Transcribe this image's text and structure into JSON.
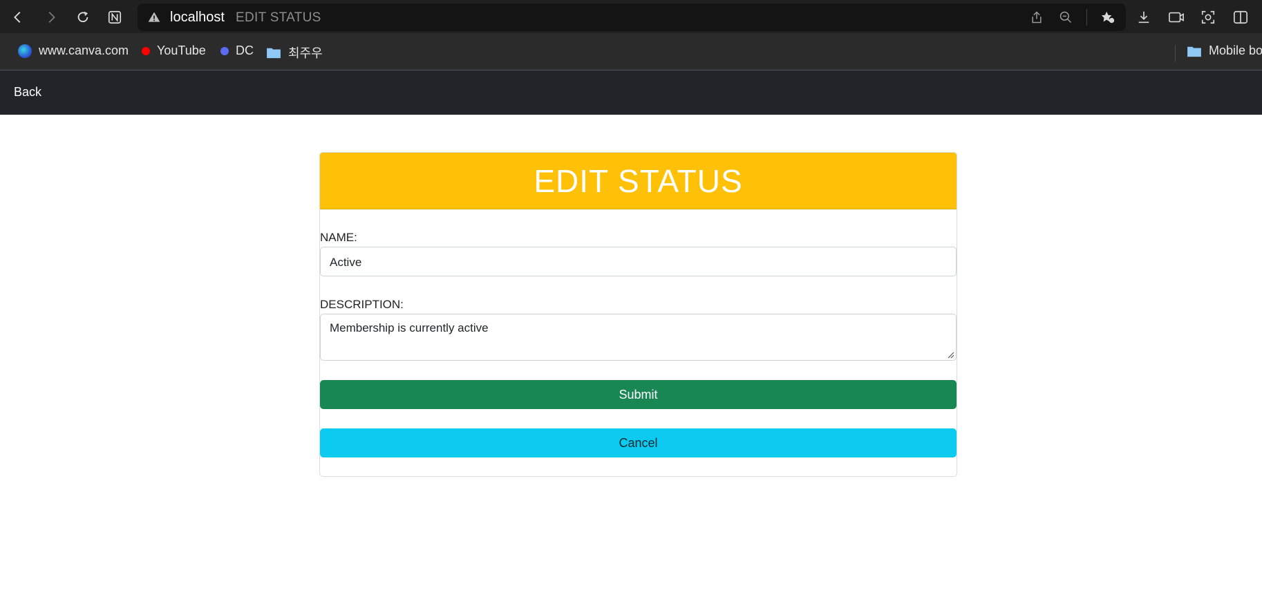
{
  "browser": {
    "address": {
      "host": "localhost",
      "page_title": "EDIT STATUS"
    },
    "bookmarks": [
      {
        "label": "www.canva.com",
        "icon": "canva-icon"
      },
      {
        "label": "YouTube",
        "icon": "youtube-dot-icon",
        "color": "#ff0000"
      },
      {
        "label": "DC",
        "icon": "dc-dot-icon",
        "color": "#5b6cf0"
      },
      {
        "label": "최주우",
        "icon": "folder-icon"
      },
      {
        "label": "Mobile bo",
        "icon": "folder-icon"
      }
    ]
  },
  "navbar": {
    "back_label": "Back"
  },
  "form": {
    "title": "EDIT STATUS",
    "name_label": "NAME:",
    "name_value": "Active",
    "description_label": "DESCRIPTION:",
    "description_value": "Membership is currently active",
    "submit_label": "Submit",
    "cancel_label": "Cancel"
  },
  "colors": {
    "header": "#ffc107",
    "submit": "#198754",
    "cancel": "#0dcaf0",
    "navbar": "#212529"
  }
}
